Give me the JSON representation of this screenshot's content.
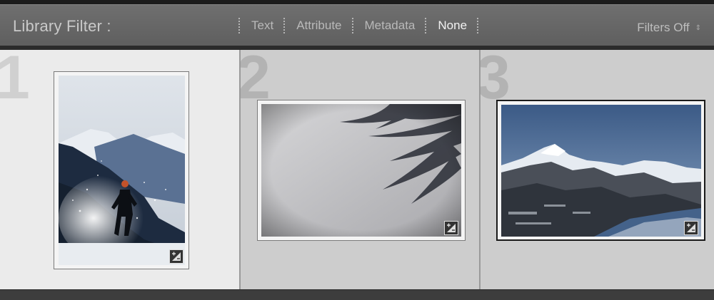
{
  "filter_bar": {
    "title": "Library Filter :",
    "tabs": [
      {
        "label": "Text"
      },
      {
        "label": "Attribute"
      },
      {
        "label": "Metadata"
      },
      {
        "label": "None",
        "active": true
      }
    ],
    "preset_label": "Filters Off"
  },
  "grid": {
    "cells": [
      {
        "index": "1",
        "selected": true,
        "subject": "runner in snow",
        "badge_icon": "develop-adjusted-icon"
      },
      {
        "index": "2",
        "selected": false,
        "subject": "palm shadow on snow",
        "badge_icon": "develop-adjusted-icon"
      },
      {
        "index": "3",
        "selected": false,
        "subject": "snowy mountain",
        "badge_icon": "develop-adjusted-icon"
      }
    ]
  },
  "colors": {
    "filter_bar_bg": "#666666",
    "active_tab": "#f2f2f2",
    "selected_cell_bg": "#ebebeb",
    "cell_bg": "#cdcdcd"
  }
}
